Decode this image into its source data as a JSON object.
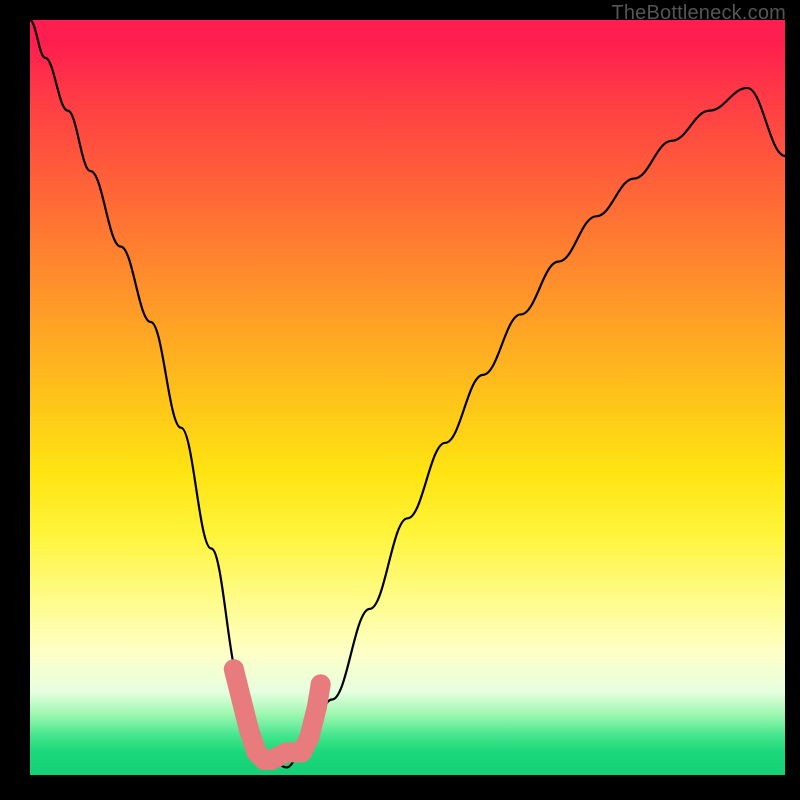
{
  "watermark": "TheBottleneck.com",
  "chart_data": {
    "type": "line",
    "title": "",
    "xlabel": "",
    "ylabel": "",
    "ylim": [
      0,
      100
    ],
    "x": [
      0,
      2,
      5,
      8,
      12,
      16,
      20,
      24,
      28,
      30,
      32,
      34,
      36,
      40,
      45,
      50,
      55,
      60,
      65,
      70,
      75,
      80,
      85,
      90,
      95,
      100
    ],
    "series": [
      {
        "name": "bottleneck-curve",
        "values": [
          100,
          95,
          88,
          80,
          70,
          60,
          46,
          30,
          12,
          5,
          2,
          1,
          3,
          10,
          22,
          34,
          44,
          53,
          61,
          68,
          74,
          79,
          84,
          88,
          91,
          82
        ]
      }
    ],
    "highlight": {
      "name": "sweet-spot",
      "color": "#e77b7e",
      "points": [
        {
          "x": 27,
          "y": 14
        },
        {
          "x": 28,
          "y": 10
        },
        {
          "x": 29,
          "y": 6
        },
        {
          "x": 30,
          "y": 3
        },
        {
          "x": 31,
          "y": 2
        },
        {
          "x": 32,
          "y": 2
        },
        {
          "x": 33,
          "y": 2.5
        },
        {
          "x": 34,
          "y": 3
        },
        {
          "x": 35,
          "y": 3
        },
        {
          "x": 36,
          "y": 3
        },
        {
          "x": 37,
          "y": 5
        },
        {
          "x": 38,
          "y": 9
        },
        {
          "x": 38.5,
          "y": 12
        }
      ]
    },
    "colors": {
      "curve": "#000000",
      "highlight": "#e77b7e",
      "gradient_top": "#ff1e4f",
      "gradient_mid": "#ffe412",
      "gradient_bottom": "#14d176"
    }
  }
}
